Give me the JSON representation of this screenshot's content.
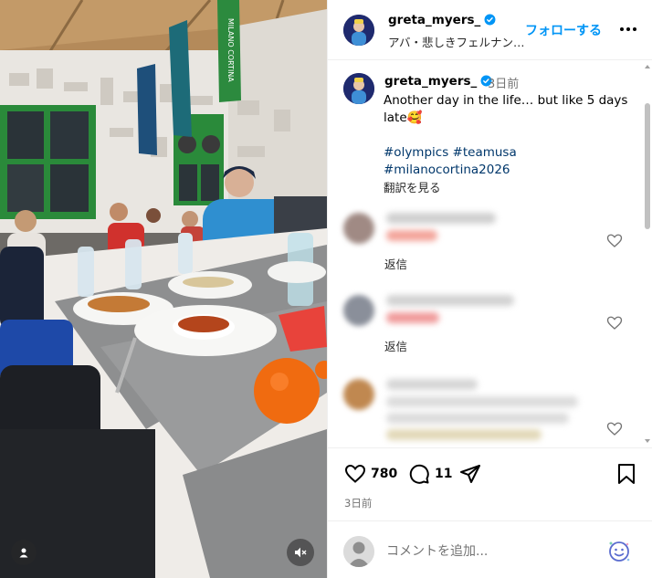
{
  "colors": {
    "accent": "#0095f6",
    "hashtag": "#00376b",
    "verified": "#0095f6",
    "muted_text": "#737373"
  },
  "media": {
    "banner_text": "MILANO CORTINA",
    "user_tags_icon": "person-icon",
    "mute_icon": "speaker-muted-icon"
  },
  "header": {
    "username": "greta_myers_",
    "audio": "アバ・悲しきフェルナン…",
    "follow_label": "フォローする",
    "more_icon": "ellipsis-icon"
  },
  "caption": {
    "username": "greta_myers_",
    "time": "3日前",
    "text": "Another day in the life… but like 5 days late🥰",
    "hashtags": "#olympics #teamusa #milanocortina2026",
    "translate_label": "翻訳を見る"
  },
  "comments": [
    {
      "reply_label": "返信"
    },
    {
      "reply_label": "返信"
    },
    {
      "reply_label": ""
    }
  ],
  "actions": {
    "likes": "780",
    "comments": "11",
    "date": "3日前"
  },
  "composer": {
    "placeholder": "コメントを追加..."
  }
}
